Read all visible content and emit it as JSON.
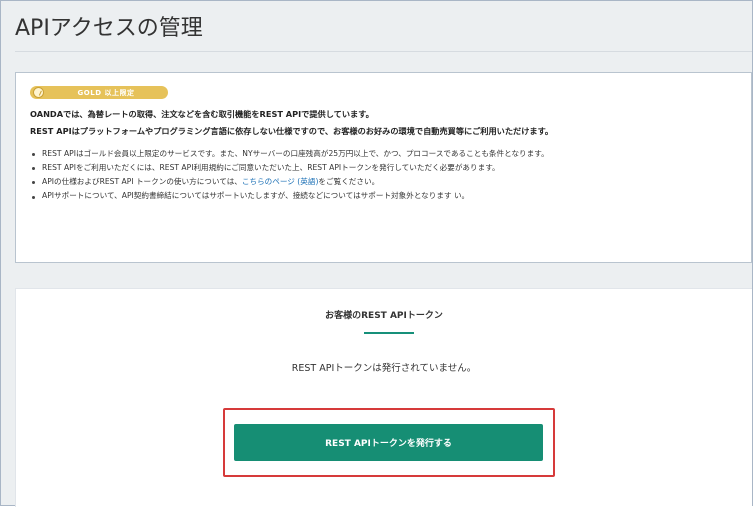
{
  "page": {
    "title": "APIアクセスの管理"
  },
  "info": {
    "badge_label": "GOLD 以上限定",
    "intro_line1": "OANDAでは、為替レートの取得、注文などを含む取引機能をREST APIで提供しています。",
    "intro_line2": "REST APIはプラットフォームやプログラミング言語に依存しない仕様ですので、お客様のお好みの環境で自動売買等にご利用いただけます。",
    "bullets": [
      {
        "text": "REST APIはゴールド会員以上限定のサービスです。また、NYサーバーの口座残高が25万円以上で、かつ、プロコースであることも条件となります。"
      },
      {
        "text": "REST APIをご利用いただくには、REST API利用規約にご同意いただいた上、REST APIトークンを発行していただく必要があります。"
      },
      {
        "prefix": "APIの仕様およびREST API トークンの使い方については、",
        "link": "こちらのページ (英語)",
        "suffix": "をご覧ください。"
      },
      {
        "text": "APIサポートについて、API契約書締結についてはサポートいたしますが、接続などについてはサポート対象外となります い。"
      }
    ]
  },
  "token": {
    "heading": "お客様のREST APIトークン",
    "status": "REST APIトークンは発行されていません。",
    "issue_button_label": "REST APIトークンを発行する"
  },
  "colors": {
    "accent_green": "#168e74",
    "highlight_red": "#d63a3a",
    "badge_gold": "#e6c25a",
    "link_blue": "#1a6fb5"
  }
}
